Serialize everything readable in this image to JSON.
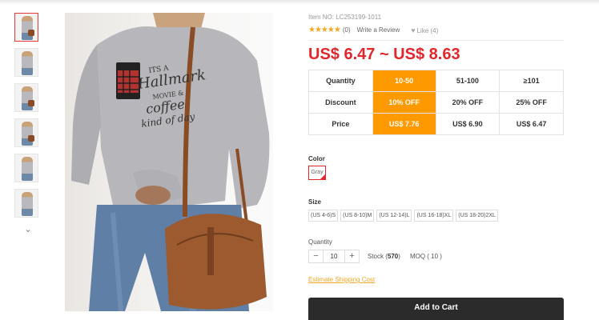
{
  "product": {
    "item_no": "Item NO: LC253199-1011",
    "rating_stars": "★★★★★",
    "review_count": "(0)",
    "write_review": "Write a Review",
    "like": "Like (4)",
    "price_range": "US$ 6.47 ~ US$ 8.63",
    "main_image_alt": "ITS A Hallmark MOVIE & coffee kind of day"
  },
  "tiers": {
    "quantity_label": "Quantity",
    "discount_label": "Discount",
    "price_label": "Price",
    "cols": [
      {
        "qty": "10-50",
        "discount": "10% OFF",
        "price": "US$ 7.76",
        "highlight": true
      },
      {
        "qty": "51-100",
        "discount": "20% OFF",
        "price": "US$ 6.90",
        "highlight": false
      },
      {
        "qty": "≥101",
        "discount": "25% OFF",
        "price": "US$ 6.47",
        "highlight": false
      }
    ]
  },
  "color": {
    "label": "Color",
    "selected": "Gray"
  },
  "size": {
    "label": "Size",
    "options": [
      "(US 4-6)S",
      "(US 8-10)M",
      "(US 12-14)L",
      "(US 16-18)XL",
      "(US 18-20)2XL"
    ]
  },
  "quantity": {
    "label": "Quantity",
    "minus": "−",
    "value": "10",
    "plus": "+",
    "stock_prefix": "Stock (",
    "stock": "570",
    "stock_suffix": ")",
    "moq": "MOQ ( 10 )"
  },
  "shipping_link": "Estimate Shipping Cost",
  "add_to_cart": "Add to Cart",
  "colors": {
    "price_red": "#e3262c",
    "tier_highlight": "#ff9900",
    "cart_button": "#2b2b2b",
    "link_orange": "#f5a623"
  }
}
